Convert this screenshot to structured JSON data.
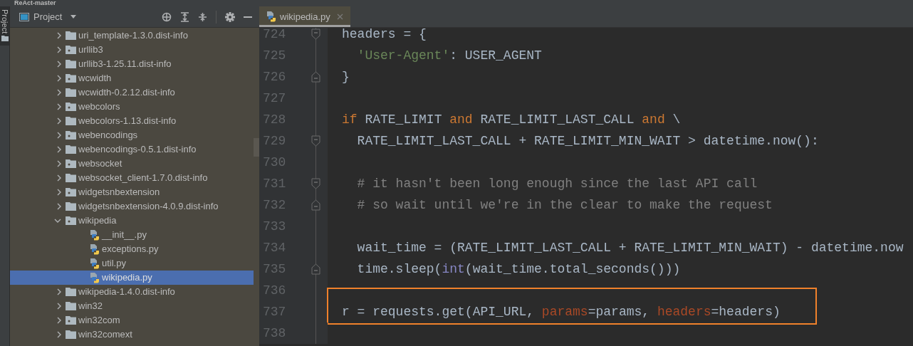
{
  "window": {
    "title": "ReAct-master"
  },
  "side_strip": {
    "label": "Project"
  },
  "project_panel": {
    "title": "Project",
    "tree": [
      {
        "label": "uri_template-1.3.0.dist-info",
        "kind": "folder",
        "expanded": false,
        "selected": false
      },
      {
        "label": "urllib3",
        "kind": "package",
        "expanded": false,
        "selected": false
      },
      {
        "label": "urllib3-1.25.11.dist-info",
        "kind": "folder",
        "expanded": false,
        "selected": false
      },
      {
        "label": "wcwidth",
        "kind": "package",
        "expanded": false,
        "selected": false
      },
      {
        "label": "wcwidth-0.2.12.dist-info",
        "kind": "folder",
        "expanded": false,
        "selected": false
      },
      {
        "label": "webcolors",
        "kind": "package",
        "expanded": false,
        "selected": false
      },
      {
        "label": "webcolors-1.13.dist-info",
        "kind": "folder",
        "expanded": false,
        "selected": false
      },
      {
        "label": "webencodings",
        "kind": "package",
        "expanded": false,
        "selected": false
      },
      {
        "label": "webencodings-0.5.1.dist-info",
        "kind": "folder",
        "expanded": false,
        "selected": false
      },
      {
        "label": "websocket",
        "kind": "package",
        "expanded": false,
        "selected": false
      },
      {
        "label": "websocket_client-1.7.0.dist-info",
        "kind": "folder",
        "expanded": false,
        "selected": false
      },
      {
        "label": "widgetsnbextension",
        "kind": "package",
        "expanded": false,
        "selected": false
      },
      {
        "label": "widgetsnbextension-4.0.9.dist-info",
        "kind": "folder",
        "expanded": false,
        "selected": false
      },
      {
        "label": "wikipedia",
        "kind": "package",
        "expanded": true,
        "selected": false,
        "children": [
          {
            "label": "__init__.py",
            "kind": "python",
            "selected": false
          },
          {
            "label": "exceptions.py",
            "kind": "python",
            "selected": false
          },
          {
            "label": "util.py",
            "kind": "python",
            "selected": false
          },
          {
            "label": "wikipedia.py",
            "kind": "python",
            "selected": true
          }
        ]
      },
      {
        "label": "wikipedia-1.4.0.dist-info",
        "kind": "folder",
        "expanded": false,
        "selected": false
      },
      {
        "label": "win32",
        "kind": "folder",
        "expanded": false,
        "selected": false
      },
      {
        "label": "win32com",
        "kind": "package",
        "expanded": false,
        "selected": false
      },
      {
        "label": "win32comext",
        "kind": "folder",
        "expanded": false,
        "selected": false
      }
    ]
  },
  "editor": {
    "tabs": [
      {
        "label": "wikipedia.py",
        "selected": true
      }
    ],
    "lines": [
      {
        "number": "724",
        "fold_start": true,
        "indented": false,
        "tokens": [
          {
            "kind": "plain",
            "text": "headers = {"
          }
        ]
      },
      {
        "number": "725",
        "indented": true,
        "tokens": [
          {
            "kind": "string",
            "text": "'User-Agent'"
          },
          {
            "kind": "plain",
            "text": ": USER_AGENT"
          }
        ]
      },
      {
        "number": "726",
        "fold_end": true,
        "indented": false,
        "tokens": [
          {
            "kind": "plain",
            "text": "}"
          }
        ]
      },
      {
        "number": "727"
      },
      {
        "number": "728",
        "indented": false,
        "tokens": [
          {
            "kind": "keyword",
            "text": "if"
          },
          {
            "kind": "plain",
            "text": " RATE_LIMIT "
          },
          {
            "kind": "keyword",
            "text": "and"
          },
          {
            "kind": "plain",
            "text": " RATE_LIMIT_LAST_CALL "
          },
          {
            "kind": "keyword",
            "text": "and"
          },
          {
            "kind": "plain",
            "text": " \\"
          }
        ]
      },
      {
        "number": "729",
        "fold_start": true,
        "indented": true,
        "tokens": [
          {
            "kind": "plain",
            "text": "RATE_LIMIT_LAST_CALL + RATE_LIMIT_MIN_WAIT > datetime.now():"
          }
        ]
      },
      {
        "number": "730"
      },
      {
        "number": "731",
        "fold_start": true,
        "indented": true,
        "tokens": [
          {
            "kind": "comment",
            "text": "# it hasn't been long enough since the last API call"
          }
        ]
      },
      {
        "number": "732",
        "fold_end": true,
        "indented": true,
        "tokens": [
          {
            "kind": "comment",
            "text": "# so wait until we're in the clear to make the request"
          }
        ]
      },
      {
        "number": "733"
      },
      {
        "number": "734",
        "indented": true,
        "tokens": [
          {
            "kind": "plain",
            "text": "wait_time = (RATE_LIMIT_LAST_CALL + RATE_LIMIT_MIN_WAIT) - datetime.now"
          }
        ]
      },
      {
        "number": "735",
        "fold_end": true,
        "indented": true,
        "tokens": [
          {
            "kind": "plain",
            "text": "time.sleep("
          },
          {
            "kind": "builtin",
            "text": "int"
          },
          {
            "kind": "plain",
            "text": "(wait_time.total_seconds()))"
          }
        ]
      },
      {
        "number": "736"
      },
      {
        "number": "737",
        "highlighted": true,
        "indented": false,
        "tokens": [
          {
            "kind": "plain",
            "text": "r = requests.get(API_URL, "
          },
          {
            "kind": "param",
            "text": "params"
          },
          {
            "kind": "plain",
            "text": "=params, "
          },
          {
            "kind": "param",
            "text": "headers"
          },
          {
            "kind": "plain",
            "text": "=headers)"
          }
        ]
      },
      {
        "number": "738"
      }
    ]
  }
}
